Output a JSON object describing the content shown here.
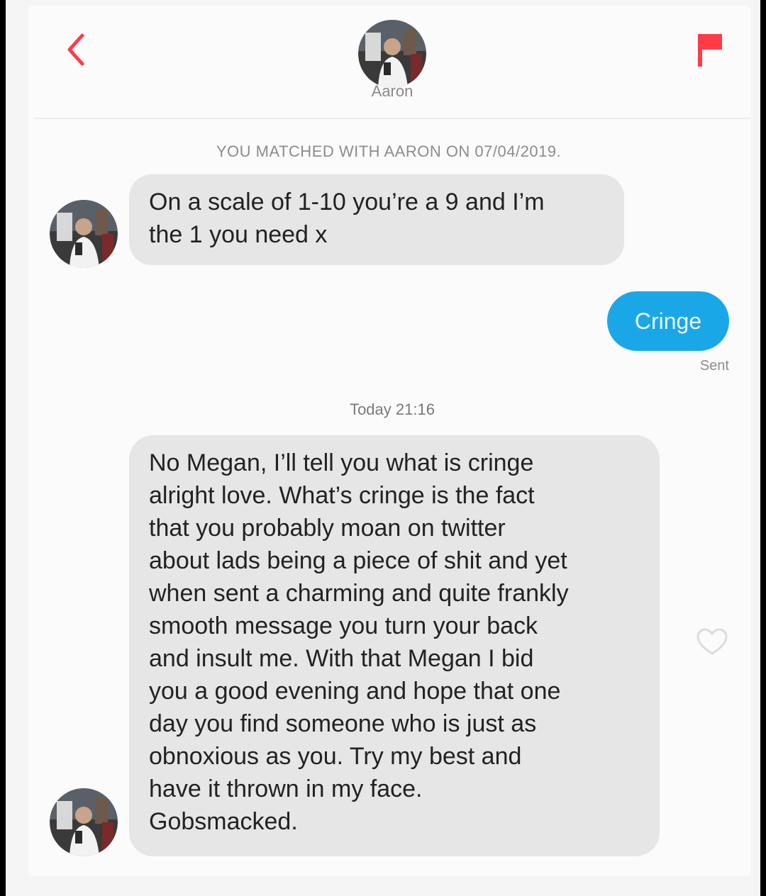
{
  "header": {
    "contact_name": "Aaron",
    "back_icon": "chevron-left-icon",
    "report_icon": "flag-icon"
  },
  "conversation": {
    "match_notice": "YOU MATCHED WITH AARON ON 07/04/2019.",
    "messages": [
      {
        "sender": "Aaron",
        "direction": "incoming",
        "text": "On a scale of 1-10 you’re a 9 and I’m\nthe 1 you need x"
      },
      {
        "sender": "me",
        "direction": "outgoing",
        "text": "Cringe",
        "status": "Sent"
      },
      {
        "sender": "Aaron",
        "direction": "incoming",
        "timestamp": "Today 21:16",
        "text": "No Megan, I’ll tell you what is cringe\nalright love.  What’s cringe is the fact\nthat you probably moan on twitter\nabout lads being a piece of shit and yet\nwhen sent a charming and quite frankly\nsmooth message you turn your back\nand insult me. With that Megan I bid\nyou a good evening and hope that one\nday you find someone who is just as\nobnoxious as you. Try my best and\nhave it thrown in my face.\nGobsmacked."
      }
    ]
  },
  "colors": {
    "outgoing_bubble": "#1aa7e8",
    "incoming_bubble": "#e6e6e6",
    "accent_red": "#ff3b47"
  }
}
